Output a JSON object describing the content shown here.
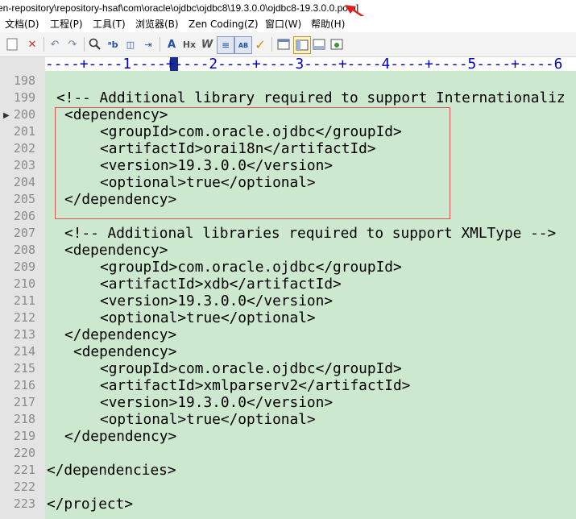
{
  "window": {
    "title": "en-repository\\repository-hsaf\\com\\oracle\\ojdbc\\ojdbc8\\19.3.0.0\\ojdbc8-19.3.0.0.pom]"
  },
  "menu": [
    "文档(D)",
    "工程(P)",
    "工具(T)",
    "浏览器(B)",
    "Zen Coding(Z)",
    "窗口(W)",
    "帮助(H)"
  ],
  "ruler": "----+----1----+----2----+----3----+----4----+----5----+----6",
  "editor": {
    "lines": [
      {
        "n": "198",
        "text": ""
      },
      {
        "n": "199",
        "text": "<!-- Additional library required to support Internationaliz"
      },
      {
        "n": "200",
        "text": "<dependency>"
      },
      {
        "n": "201",
        "text": "<groupId>com.oracle.ojdbc</groupId>"
      },
      {
        "n": "202",
        "text": "<artifactId>orai18n</artifactId>"
      },
      {
        "n": "203",
        "text": "<version>19.3.0.0</version>"
      },
      {
        "n": "204",
        "text": "<optional>true</optional>"
      },
      {
        "n": "205",
        "text": "</dependency>"
      },
      {
        "n": "206",
        "text": ""
      },
      {
        "n": "207",
        "text": "<!-- Additional libraries required to support XMLType -->"
      },
      {
        "n": "208",
        "text": "<dependency>"
      },
      {
        "n": "209",
        "text": "<groupId>com.oracle.ojdbc</groupId>"
      },
      {
        "n": "210",
        "text": "<artifactId>xdb</artifactId>"
      },
      {
        "n": "211",
        "text": "<version>19.3.0.0</version>"
      },
      {
        "n": "212",
        "text": "<optional>true</optional>"
      },
      {
        "n": "213",
        "text": "</dependency>"
      },
      {
        "n": "214",
        "text": "<dependency>"
      },
      {
        "n": "215",
        "text": "<groupId>com.oracle.ojdbc</groupId>"
      },
      {
        "n": "216",
        "text": "<artifactId>xmlparserv2</artifactId>"
      },
      {
        "n": "217",
        "text": "<version>19.3.0.0</version>"
      },
      {
        "n": "218",
        "text": "<optional>true</optional>"
      },
      {
        "n": "219",
        "text": "</dependency>"
      },
      {
        "n": "220",
        "text": ""
      },
      {
        "n": "221",
        "text": "</dependencies>"
      },
      {
        "n": "222",
        "text": ""
      },
      {
        "n": "223",
        "text": "</project>"
      }
    ]
  },
  "toolbar_icons": [
    "close-file-icon",
    "undo-icon",
    "redo-icon",
    "find-icon",
    "replace-icon",
    "indent-icon",
    "font-icon",
    "heading-icon",
    "italic-icon",
    "word-wrap-icon",
    "spell-check-icon",
    "check-icon",
    "view-icon",
    "view-split-icon",
    "view-output-icon",
    "view-browser-icon"
  ],
  "colors": {
    "code_background": "#cce8cf",
    "gutter": "#e4e4e4",
    "highlight_box": "#e25353",
    "annotation_arrow": "#e02020"
  }
}
